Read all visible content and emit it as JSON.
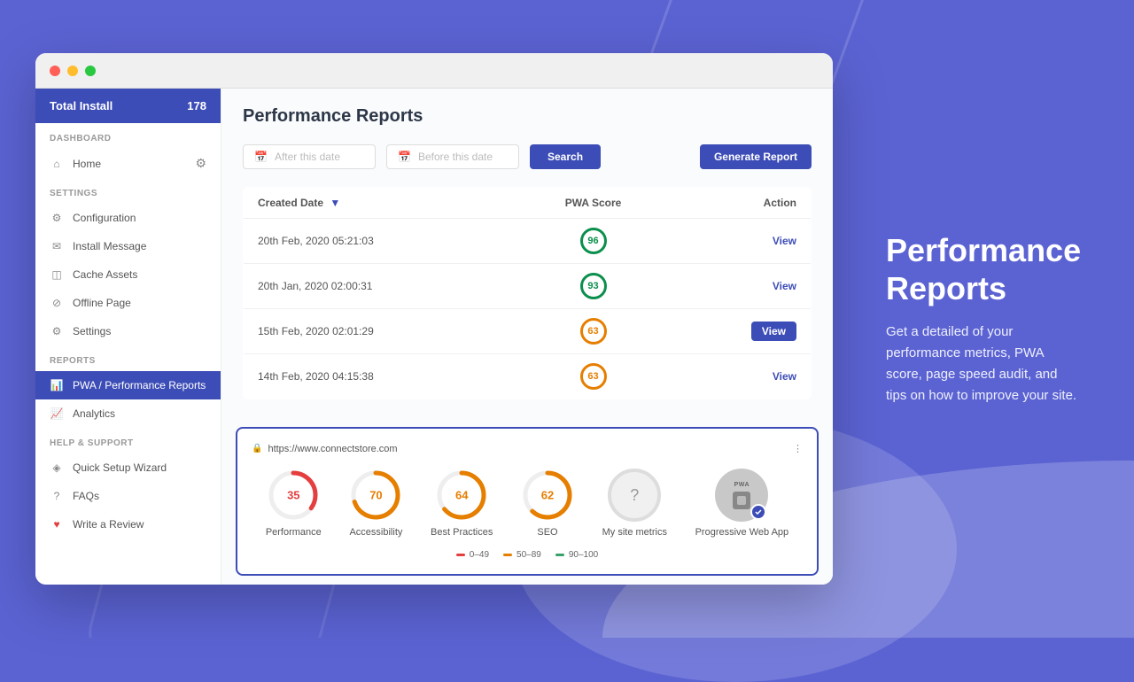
{
  "browser": {
    "dots": [
      "red",
      "yellow",
      "green"
    ]
  },
  "sidebar": {
    "header": {
      "title": "Total Install",
      "count": "178"
    },
    "sections": [
      {
        "label": "DASHBOARD",
        "items": [
          {
            "id": "home",
            "label": "Home",
            "icon": "home"
          }
        ]
      },
      {
        "label": "SETTINGS",
        "items": [
          {
            "id": "configuration",
            "label": "Configuration",
            "icon": "gear"
          },
          {
            "id": "install-message",
            "label": "Install Message",
            "icon": "message"
          },
          {
            "id": "cache-assets",
            "label": "Cache Assets",
            "icon": "cache"
          },
          {
            "id": "offline-page",
            "label": "Offline Page",
            "icon": "wifi-off"
          },
          {
            "id": "settings",
            "label": "Settings",
            "icon": "settings"
          }
        ]
      },
      {
        "label": "REPORTS",
        "items": [
          {
            "id": "pwa-reports",
            "label": "PWA / Performance Reports",
            "icon": "chart",
            "active": true
          },
          {
            "id": "analytics",
            "label": "Analytics",
            "icon": "analytics"
          }
        ]
      },
      {
        "label": "HELP & SUPPORT",
        "items": [
          {
            "id": "quick-setup",
            "label": "Quick Setup Wizard",
            "icon": "wizard"
          },
          {
            "id": "faqs",
            "label": "FAQs",
            "icon": "question"
          },
          {
            "id": "write-review",
            "label": "Write a Review",
            "icon": "heart"
          }
        ]
      }
    ]
  },
  "main": {
    "title": "Performance Reports",
    "filter": {
      "after_placeholder": "After this date",
      "before_placeholder": "Before this date",
      "search_label": "Search",
      "generate_label": "Generate Report"
    },
    "table": {
      "columns": [
        "Created Date",
        "PWA Score",
        "Action"
      ],
      "rows": [
        {
          "date": "20th Feb, 2020 05:21:03",
          "score": 96,
          "score_type": "green",
          "action": "View"
        },
        {
          "date": "20th Jan, 2020 02:00:31",
          "score": 93,
          "score_type": "green",
          "action": "View"
        },
        {
          "date": "15th Feb, 2020 02:01:29",
          "score": 63,
          "score_type": "orange",
          "action": "View",
          "highlighted": true
        },
        {
          "date": "14th Feb, 2020 04:15:38",
          "score": 63,
          "score_type": "orange",
          "action": "View"
        }
      ]
    }
  },
  "popup": {
    "url": "https://www.connectstore.com",
    "metrics": [
      {
        "id": "performance",
        "label": "Performance",
        "value": "35",
        "type": "red",
        "pct": 35
      },
      {
        "id": "accessibility",
        "label": "Accessibility",
        "value": "70",
        "type": "orange",
        "pct": 70
      },
      {
        "id": "best-practices",
        "label": "Best Practices",
        "value": "64",
        "type": "orange",
        "pct": 64
      },
      {
        "id": "seo",
        "label": "SEO",
        "value": "62",
        "type": "orange",
        "pct": 62
      },
      {
        "id": "my-site",
        "label": "My site metrics",
        "value": "?",
        "type": "unknown"
      },
      {
        "id": "pwa",
        "label": "Progressive Web App",
        "value": "PWA",
        "type": "pwa"
      }
    ],
    "legend": [
      {
        "range": "0–49",
        "color": "red"
      },
      {
        "range": "50–89",
        "color": "orange"
      },
      {
        "range": "90–100",
        "color": "green"
      }
    ]
  },
  "right_panel": {
    "title": "Performance Reports",
    "description": "Get a detailed of your performance metrics, PWA score, page speed audit, and tips on how to improve your site."
  }
}
